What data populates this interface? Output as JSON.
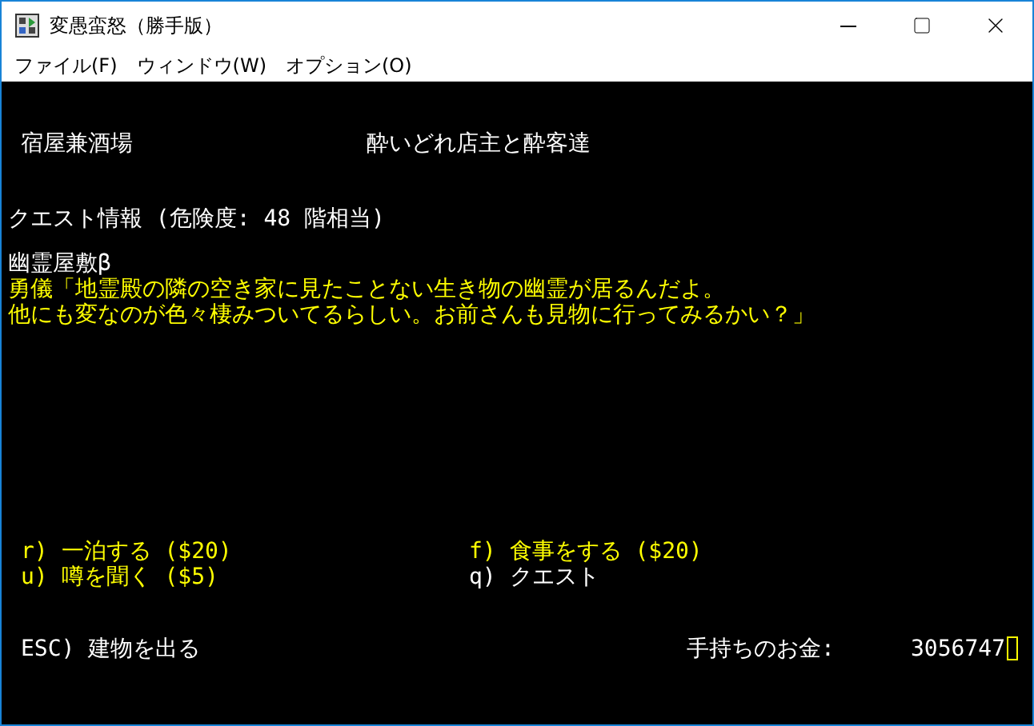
{
  "window": {
    "title": "変愚蛮怒（勝手版）"
  },
  "menu": [
    "ファイル(F)",
    "ウィンドウ(W)",
    "オプション(O)"
  ],
  "terminal": {
    "building": "宿屋兼酒場",
    "owner": "酔いどれ店主と酔客達",
    "quest_header": "クエスト情報 (危険度: 48 階相当)",
    "quest_title": "幽霊屋敷β",
    "quest_text": [
      "勇儀「地霊殿の隣の空き家に見たことない生き物の幽霊が居るんだよ。",
      "他にも変なのが色々棲みついてるらしい。お前さんも見物に行ってみるかい？」"
    ],
    "commands": [
      {
        "text": "r) 一泊する ($20)",
        "highlighted": true
      },
      {
        "text": "f) 食事をする ($20)",
        "highlighted": true
      },
      {
        "text": "u) 噂を聞く ($5)",
        "highlighted": true
      },
      {
        "text": "q) クエスト",
        "highlighted": false
      }
    ],
    "exit": "ESC) 建物を出る",
    "gold_label": "手持ちのお金:",
    "gold": "3056747"
  }
}
